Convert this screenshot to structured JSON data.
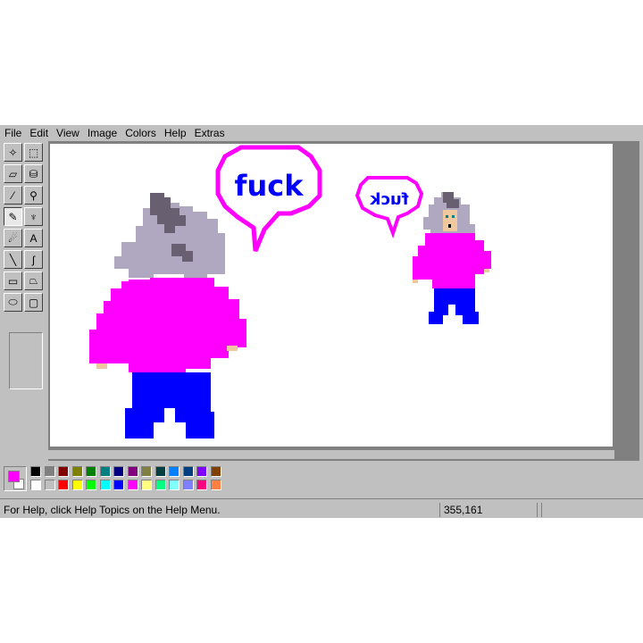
{
  "menu": {
    "file": "File",
    "edit": "Edit",
    "view": "View",
    "image": "Image",
    "colors": "Colors",
    "help": "Help",
    "extras": "Extras"
  },
  "tools": [
    {
      "name": "free-form-select-icon",
      "glyph": "✧"
    },
    {
      "name": "select-icon",
      "glyph": "⬚"
    },
    {
      "name": "eraser-icon",
      "glyph": "▱"
    },
    {
      "name": "fill-bucket-icon",
      "glyph": "⛁"
    },
    {
      "name": "eyedropper-icon",
      "glyph": "⁄"
    },
    {
      "name": "magnifier-icon",
      "glyph": "⚲"
    },
    {
      "name": "pencil-icon",
      "glyph": "✎"
    },
    {
      "name": "brush-icon",
      "glyph": "♆"
    },
    {
      "name": "airbrush-icon",
      "glyph": "☄"
    },
    {
      "name": "text-icon",
      "glyph": "A"
    },
    {
      "name": "line-icon",
      "glyph": "╲"
    },
    {
      "name": "curve-icon",
      "glyph": "ʃ"
    },
    {
      "name": "rectangle-icon",
      "glyph": "▭"
    },
    {
      "name": "polygon-icon",
      "glyph": "⏢"
    },
    {
      "name": "ellipse-icon",
      "glyph": "⬭"
    },
    {
      "name": "rounded-rectangle-icon",
      "glyph": "▢"
    }
  ],
  "canvas": {
    "bubble_large_text": "fuck",
    "bubble_small_text": "fuck"
  },
  "palette": {
    "foreground": "#ff00ff",
    "background": "#ffffff",
    "colors_top": [
      "#000000",
      "#808080",
      "#800000",
      "#808000",
      "#008000",
      "#008080",
      "#000080",
      "#800080",
      "#808040",
      "#004040",
      "#0080ff",
      "#004080",
      "#8000ff",
      "#804000"
    ],
    "colors_bottom": [
      "#ffffff",
      "#c0c0c0",
      "#ff0000",
      "#ffff00",
      "#00ff00",
      "#00ffff",
      "#0000ff",
      "#ff00ff",
      "#ffff80",
      "#00ff80",
      "#80ffff",
      "#8080ff",
      "#ff0080",
      "#ff8040"
    ]
  },
  "status": {
    "help_text": "For Help, click Help Topics on the Help Menu.",
    "coords": "355,161"
  },
  "colors": {
    "hoodie": "#ff00ff",
    "pants": "#0000ff",
    "hair": "#b0a8c0",
    "hair_dark": "#686070",
    "skin": "#f0c8a0"
  }
}
